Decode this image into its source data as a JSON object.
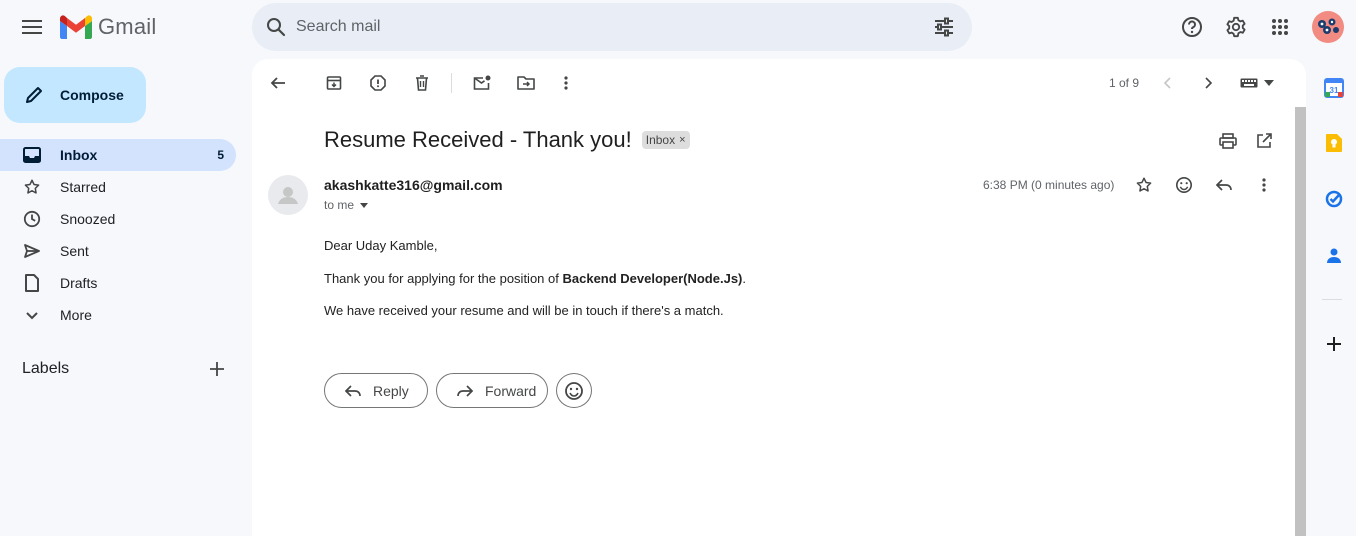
{
  "app": {
    "name": "Gmail",
    "search_placeholder": "Search mail"
  },
  "colors": {
    "accent": "#c2e7ff",
    "active_nav": "#d3e3fd",
    "background": "#f6f8fc",
    "logo_red": "#ea4335",
    "logo_blue": "#4285f4",
    "logo_green": "#34a853",
    "logo_yellow": "#fbbc04"
  },
  "sidebar": {
    "compose_label": "Compose",
    "items": [
      {
        "label": "Inbox",
        "icon": "inbox-icon",
        "count": "5",
        "active": true
      },
      {
        "label": "Starred",
        "icon": "star-icon",
        "count": ""
      },
      {
        "label": "Snoozed",
        "icon": "clock-icon",
        "count": ""
      },
      {
        "label": "Sent",
        "icon": "send-icon",
        "count": ""
      },
      {
        "label": "Drafts",
        "icon": "draft-icon",
        "count": ""
      },
      {
        "label": "More",
        "icon": "chevron-down-icon",
        "count": ""
      }
    ],
    "labels_title": "Labels"
  },
  "toolbar": {
    "pagination": "1 of 9"
  },
  "email": {
    "subject": "Resume Received - Thank you!",
    "label_badge": "Inbox",
    "badge_close": "×",
    "sender": "akashkatte316@gmail.com",
    "recipient": "to me",
    "timestamp": "6:38 PM (0 minutes ago)",
    "greeting": "Dear Uday Kamble,",
    "line1_prefix": "Thank you for applying for the position of ",
    "line1_bold": "Backend Developer(Node.Js)",
    "line1_suffix": ".",
    "line2": "We have received your resume and will be in touch if there's a match."
  },
  "actions": {
    "reply_label": "Reply",
    "forward_label": "Forward"
  },
  "side_panel": {
    "calendar_day": "31"
  }
}
